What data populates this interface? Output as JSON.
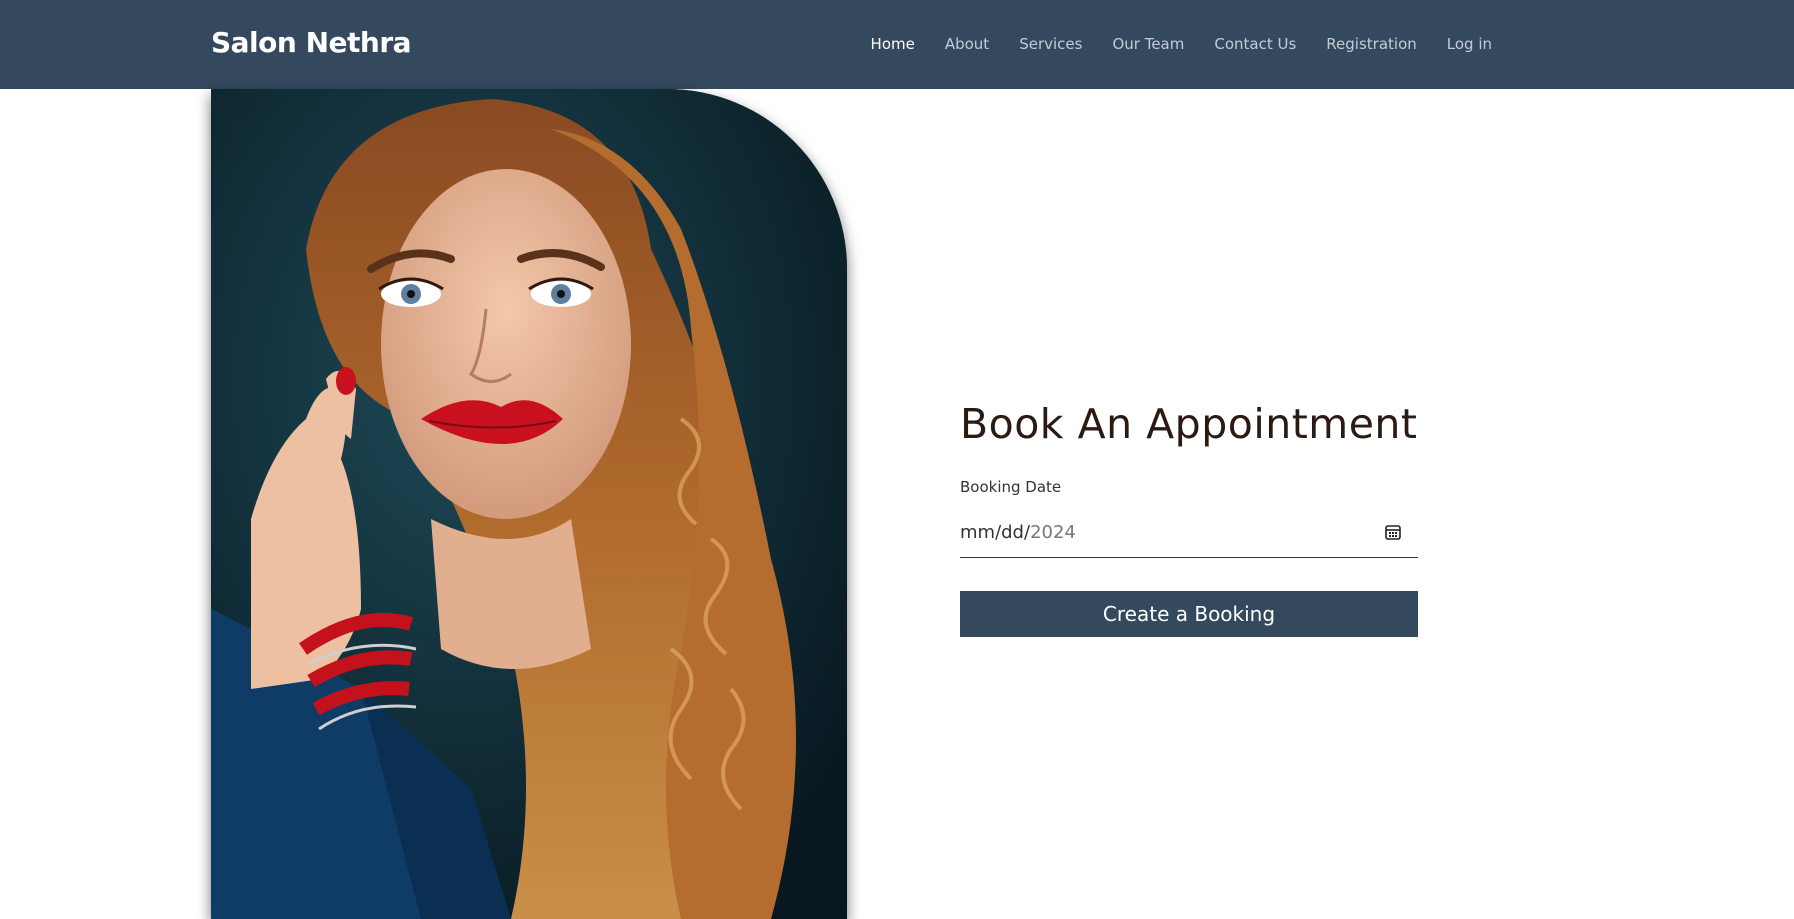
{
  "brand": "Salon Nethra",
  "nav": {
    "items": [
      {
        "label": "Home",
        "active": true
      },
      {
        "label": "About"
      },
      {
        "label": "Services"
      },
      {
        "label": "Our Team"
      },
      {
        "label": "Contact Us"
      },
      {
        "label": "Registration"
      },
      {
        "label": "Log in"
      }
    ]
  },
  "booking": {
    "title": "Book An Appointment",
    "date_label": "Booking Date",
    "date_placeholder_prefix": "mm/dd/",
    "date_year": "2024",
    "submit_label": "Create a Booking"
  },
  "colors": {
    "navbar": "#34495e",
    "button": "#34495e"
  }
}
